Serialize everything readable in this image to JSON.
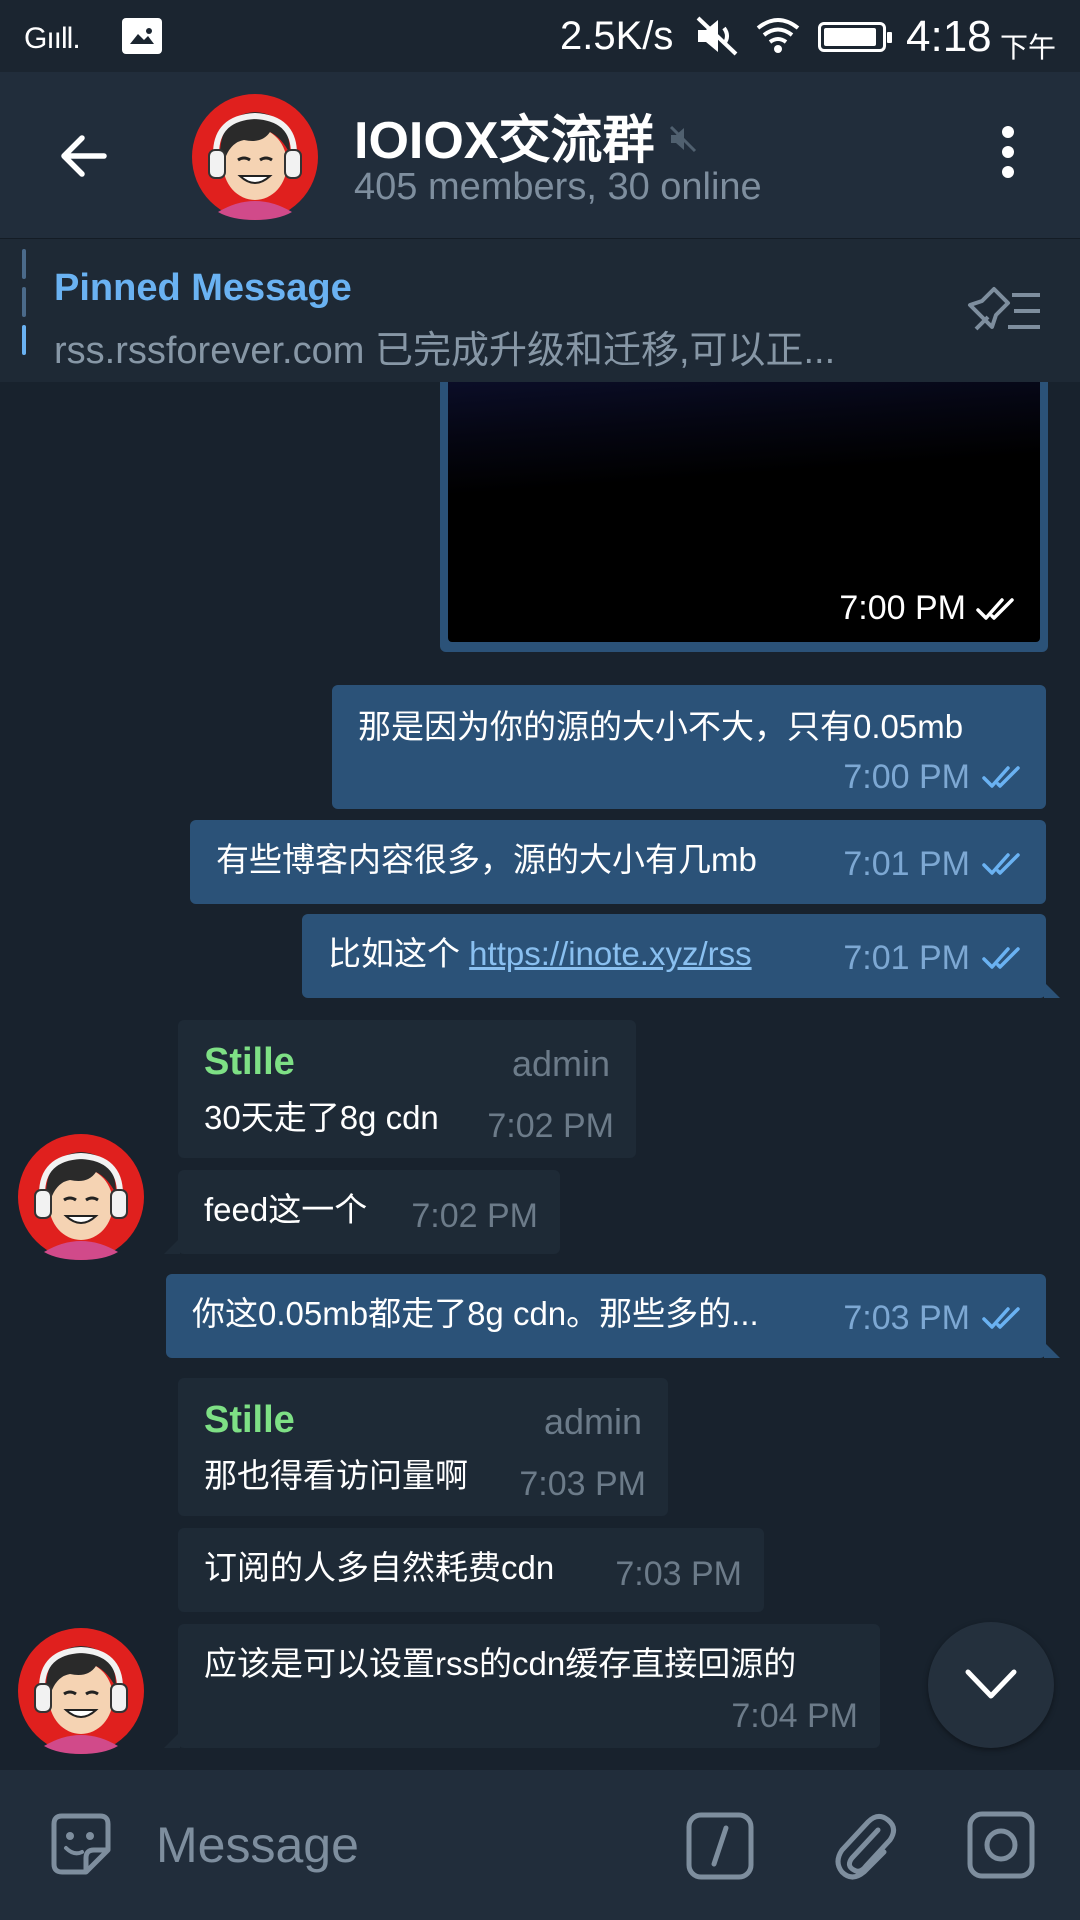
{
  "status_bar": {
    "signal": "Gııll.",
    "net_speed": "2.5K/s",
    "time": "4:18",
    "ampm": "下午",
    "battery_level": 0.92
  },
  "header": {
    "title": "IOIOX交流群",
    "subtitle": "405 members, 30 online"
  },
  "pinned": {
    "label": "Pinned Message",
    "text": "rss.rssforever.com 已完成升级和迁移,可以正..."
  },
  "messages": [
    {
      "id": "m0",
      "type": "media",
      "direction": "out",
      "time": "7:00 PM"
    },
    {
      "id": "m1",
      "direction": "out",
      "text": "那是因为你的源的大小不大，只有0.05mb",
      "time": "7:00 PM"
    },
    {
      "id": "m2",
      "direction": "out",
      "text": "有些博客内容很多，源的大小有几mb",
      "time": "7:01 PM"
    },
    {
      "id": "m3",
      "direction": "out",
      "text_prefix": "比如这个 ",
      "link": "https://inote.xyz/rss",
      "time": "7:01 PM"
    },
    {
      "id": "m4",
      "direction": "in",
      "sender": "Stille",
      "role": "admin",
      "text": "30天走了8g cdn",
      "time": "7:02 PM"
    },
    {
      "id": "m5",
      "direction": "in",
      "text": "feed这一个",
      "time": "7:02 PM"
    },
    {
      "id": "m6",
      "direction": "out",
      "text": "你这0.05mb都走了8g cdn。那些多的...",
      "time": "7:03 PM"
    },
    {
      "id": "m7",
      "direction": "in",
      "sender": "Stille",
      "role": "admin",
      "text": "那也得看访问量啊",
      "time": "7:03 PM"
    },
    {
      "id": "m8",
      "direction": "in",
      "text": "订阅的人多自然耗费cdn",
      "time": "7:03 PM"
    },
    {
      "id": "m9",
      "direction": "in",
      "text": "应该是可以设置rss的cdn缓存直接回源的",
      "time": "7:04 PM"
    }
  ],
  "input": {
    "placeholder": "Message"
  },
  "colors": {
    "accent": "#6ab2f2",
    "sender_name": "#7ee085",
    "outgoing_bubble": "#2b5278",
    "incoming_bubble": "#1e2a36",
    "background": "#18222d"
  },
  "icons": {
    "back": "arrow-left-icon",
    "menu": "kebab-menu-icon",
    "muted": "muted-speaker-icon",
    "pin": "pin-list-icon",
    "emoji": "sticker-icon",
    "command": "slash-command-icon",
    "attach": "paperclip-icon",
    "camera": "camera-icon",
    "scroll": "chevron-down-icon",
    "read": "double-check-icon"
  }
}
